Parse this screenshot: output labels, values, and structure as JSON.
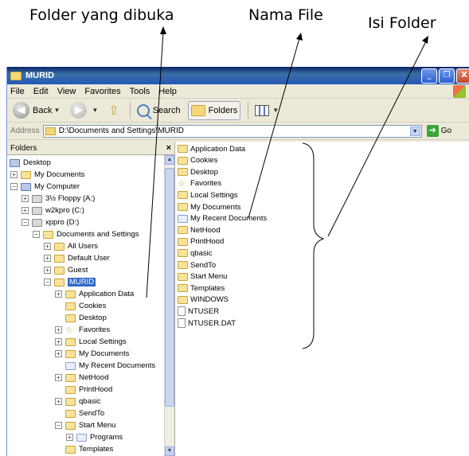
{
  "annotations": {
    "folder_opened": "Folder yang dibuka",
    "file_name": "Nama File",
    "folder_contents": "Isi Folder"
  },
  "window": {
    "title": "MURID",
    "buttons": {
      "minimize": "_",
      "maximize": "❐",
      "close": "X"
    }
  },
  "menu": [
    "File",
    "Edit",
    "View",
    "Favorites",
    "Tools",
    "Help"
  ],
  "toolbar": {
    "back_label": "Back",
    "search_label": "Search",
    "folders_label": "Folders"
  },
  "address": {
    "label": "Address",
    "value": "D:\\Documents and Settings\\MURID",
    "go_label": "Go"
  },
  "folders_pane": {
    "title": "Folders",
    "close": "×",
    "tree": [
      {
        "label": "Desktop",
        "level": 0,
        "pm": "",
        "icon": "desktop-icon"
      },
      {
        "label": "My Documents",
        "level": 1,
        "pm": "+",
        "icon": "folder-icon"
      },
      {
        "label": "My Computer",
        "level": 1,
        "pm": "−",
        "icon": "computer-icon"
      },
      {
        "label": "3½ Floppy (A:)",
        "level": 2,
        "pm": "+",
        "icon": "floppy-icon"
      },
      {
        "label": "w2kpro (C:)",
        "level": 2,
        "pm": "+",
        "icon": "drive-icon"
      },
      {
        "label": "xppro (D:)",
        "level": 2,
        "pm": "−",
        "icon": "drive-icon"
      },
      {
        "label": "Documents and Settings",
        "level": 3,
        "pm": "−",
        "icon": "folder-icon"
      },
      {
        "label": "All Users",
        "level": 4,
        "pm": "+",
        "icon": "folder-icon"
      },
      {
        "label": "Default User",
        "level": 4,
        "pm": "+",
        "icon": "folder-icon"
      },
      {
        "label": "Guest",
        "level": 4,
        "pm": "+",
        "icon": "folder-icon"
      },
      {
        "label": "MURID",
        "level": 4,
        "pm": "−",
        "icon": "folder-icon",
        "selected": true
      },
      {
        "label": "Application Data",
        "level": 5,
        "pm": "+",
        "icon": "folder-icon"
      },
      {
        "label": "Cookies",
        "level": 5,
        "pm": "",
        "icon": "folder-icon"
      },
      {
        "label": "Desktop",
        "level": 5,
        "pm": "",
        "icon": "folder-icon"
      },
      {
        "label": "Favorites",
        "level": 5,
        "pm": "+",
        "icon": "star-icon"
      },
      {
        "label": "Local Settings",
        "level": 5,
        "pm": "+",
        "icon": "folder-icon"
      },
      {
        "label": "My Documents",
        "level": 5,
        "pm": "+",
        "icon": "folder-icon"
      },
      {
        "label": "My Recent Documents",
        "level": 5,
        "pm": "",
        "icon": "recent-docs-icon"
      },
      {
        "label": "NetHood",
        "level": 5,
        "pm": "+",
        "icon": "folder-icon"
      },
      {
        "label": "PrintHood",
        "level": 5,
        "pm": "",
        "icon": "folder-icon"
      },
      {
        "label": "qbasic",
        "level": 5,
        "pm": "+",
        "icon": "folder-icon"
      },
      {
        "label": "SendTo",
        "level": 5,
        "pm": "",
        "icon": "folder-icon"
      },
      {
        "label": "Start Menu",
        "level": 5,
        "pm": "−",
        "icon": "folder-icon"
      },
      {
        "label": "Programs",
        "level": 6,
        "pm": "+",
        "icon": "programs-icon"
      },
      {
        "label": "Templates",
        "level": 5,
        "pm": "",
        "icon": "folder-icon"
      }
    ]
  },
  "files": [
    {
      "name": "Application Data",
      "icon": "folder-icon"
    },
    {
      "name": "Cookies",
      "icon": "folder-icon"
    },
    {
      "name": "Desktop",
      "icon": "folder-icon"
    },
    {
      "name": "Favorites",
      "icon": "star-icon"
    },
    {
      "name": "Local Settings",
      "icon": "folder-icon"
    },
    {
      "name": "My Documents",
      "icon": "folder-icon"
    },
    {
      "name": "My Recent Documents",
      "icon": "recent-docs-icon"
    },
    {
      "name": "NetHood",
      "icon": "folder-icon"
    },
    {
      "name": "PrintHood",
      "icon": "folder-icon"
    },
    {
      "name": "qbasic",
      "icon": "folder-icon"
    },
    {
      "name": "SendTo",
      "icon": "folder-icon"
    },
    {
      "name": "Start Menu",
      "icon": "folder-icon"
    },
    {
      "name": "Templates",
      "icon": "folder-icon"
    },
    {
      "name": "WINDOWS",
      "icon": "folder-icon"
    },
    {
      "name": "NTUSER",
      "icon": "file-icon"
    },
    {
      "name": "NTUSER.DAT",
      "icon": "file-icon"
    }
  ]
}
